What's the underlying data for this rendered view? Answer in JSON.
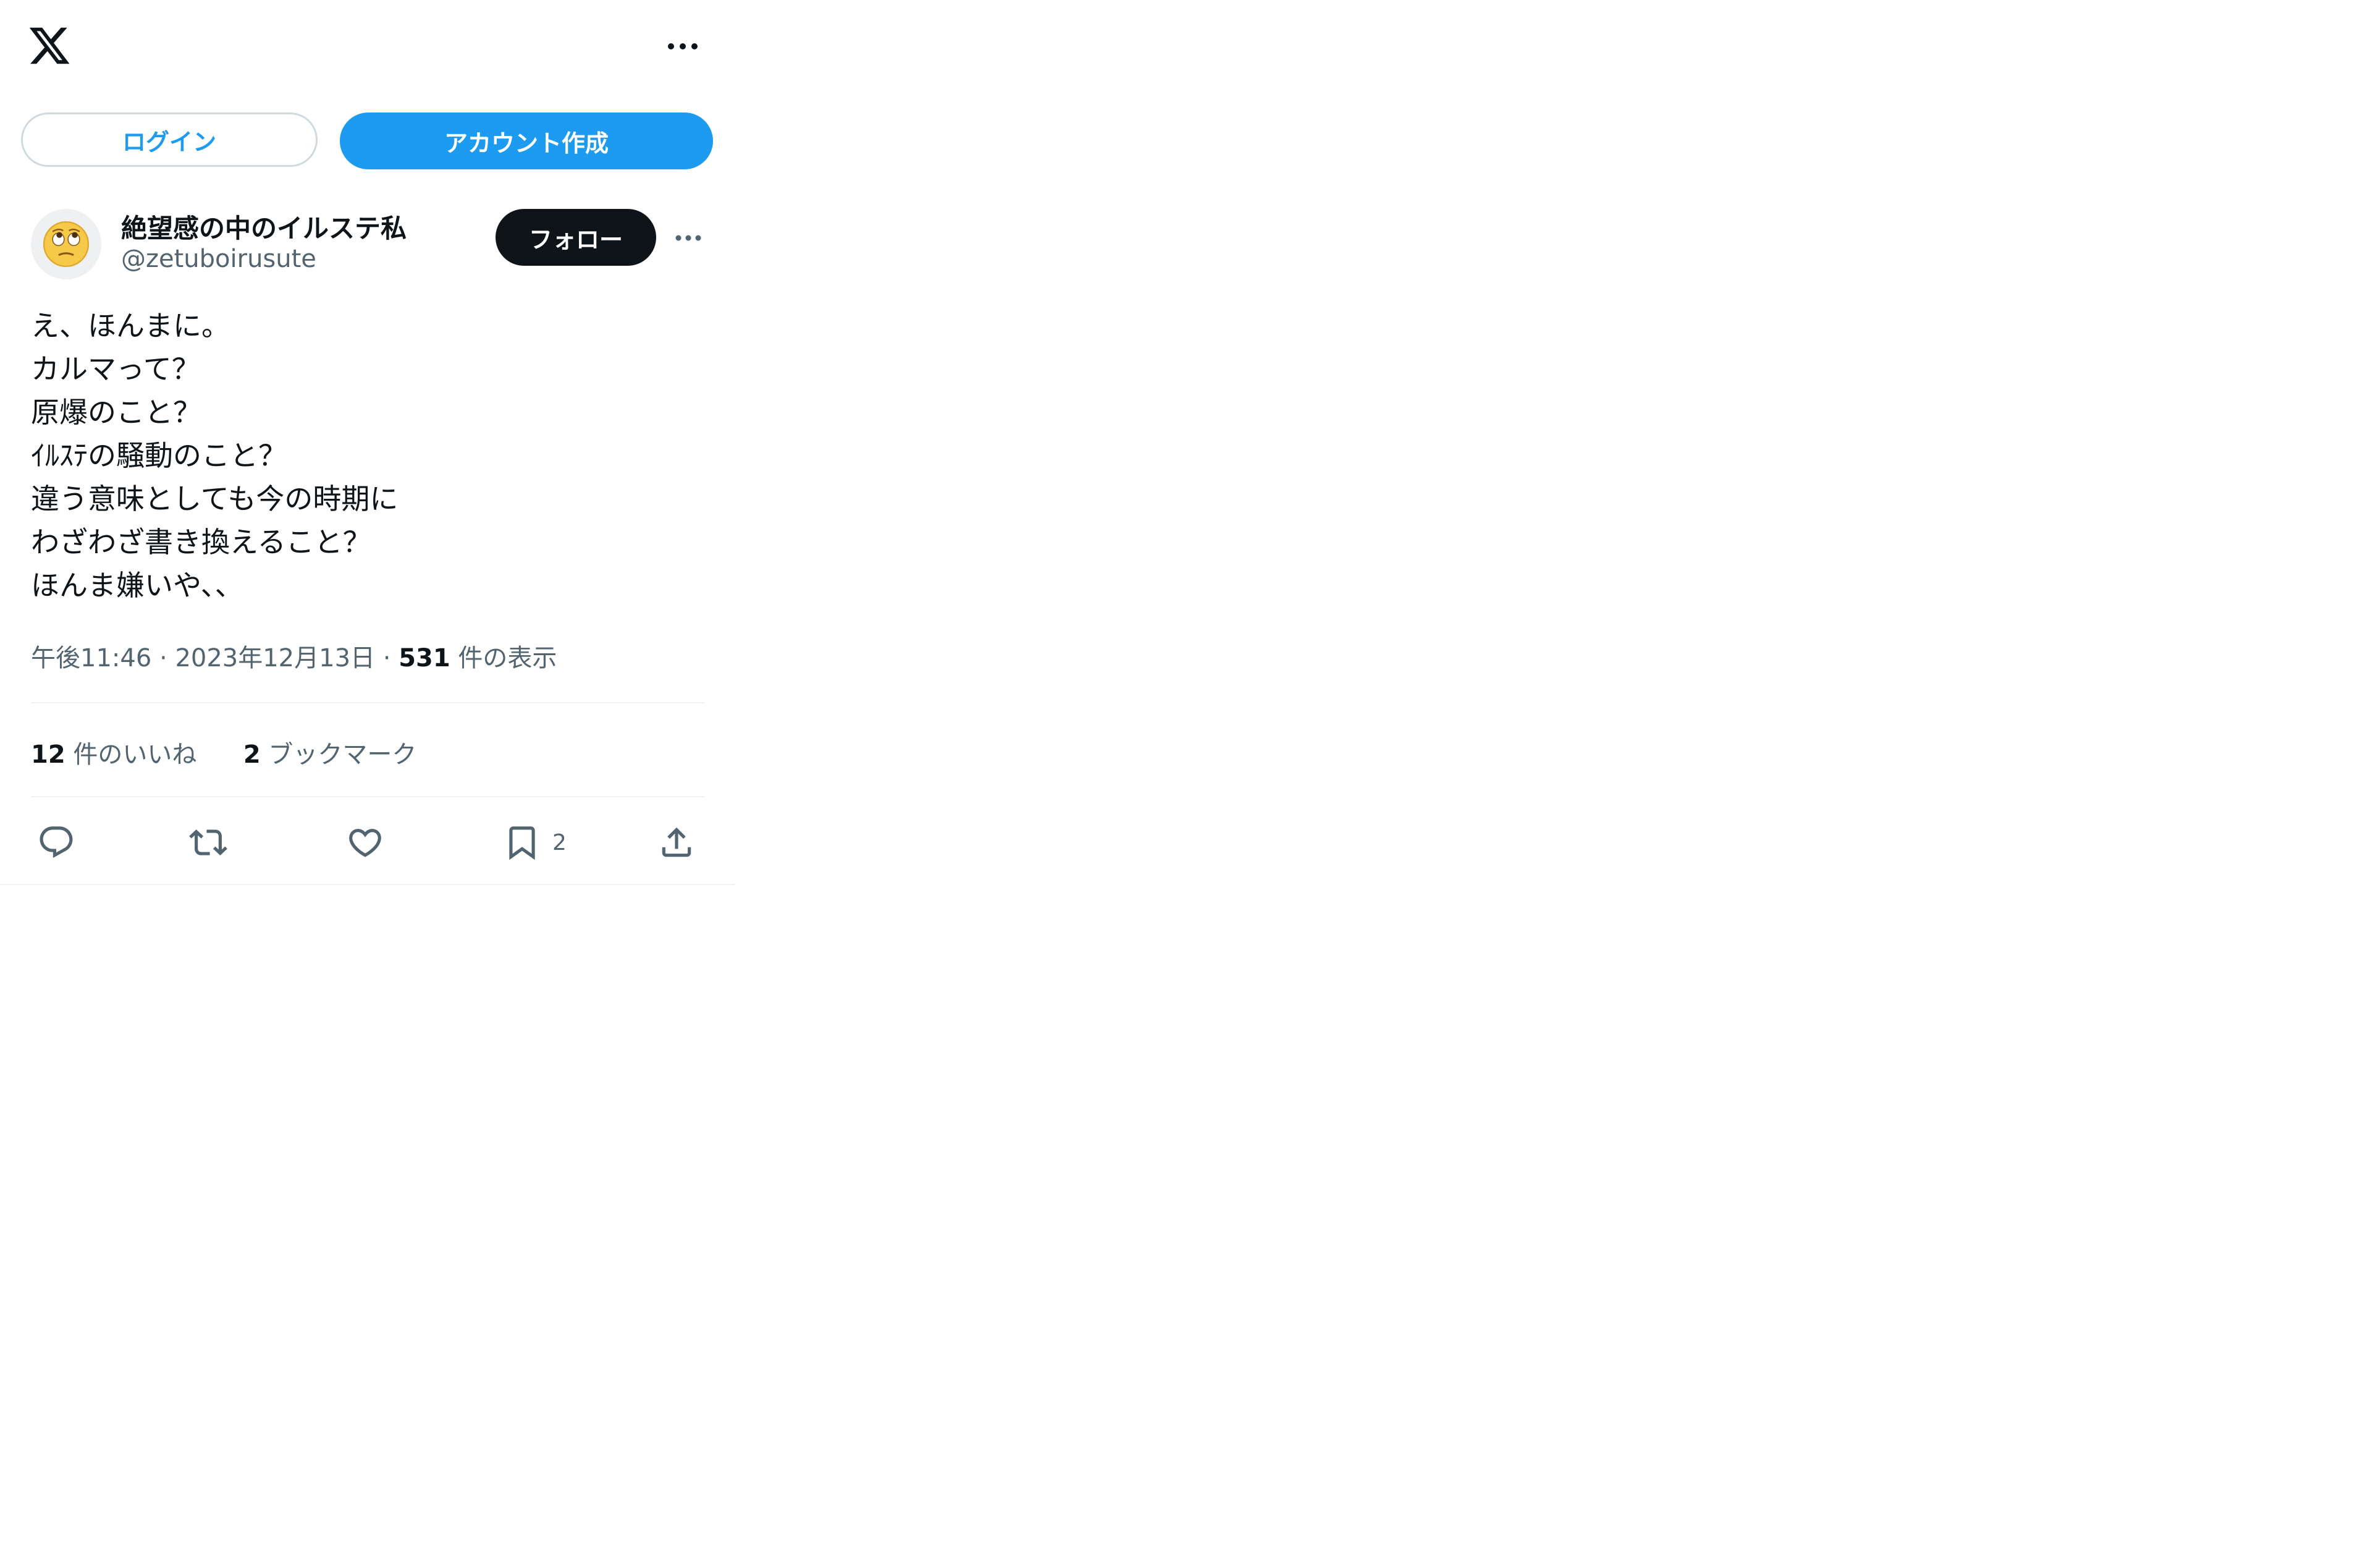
{
  "header": {
    "logo_icon": "x-logo-icon",
    "more_icon": "more-horizontal-icon"
  },
  "auth": {
    "login_label": "ログイン",
    "signup_label": "アカウント作成"
  },
  "tweet": {
    "author": {
      "display_name": "絶望感の中のイルステ私",
      "handle": "@zetuboirusute",
      "avatar_emoji": "🙄"
    },
    "follow_label": "フォロー",
    "text_lines": [
      "え、ほんまに。",
      "カルマって？",
      "原爆のこと？",
      "ｲﾙｽﾃの騒動のこと？",
      "違う意味としても今の時期に",
      "わざわざ書き換えること？",
      "ほんま嫌いや、、"
    ],
    "meta": {
      "time": "午後11:46",
      "dot1": "·",
      "date": "2023年12月13日",
      "dot2": "·",
      "views_count": "531",
      "views_label": "件の表示"
    },
    "stats": {
      "likes_count": "12",
      "likes_label": "件のいいね",
      "bookmarks_count": "2",
      "bookmarks_label": "ブックマーク"
    },
    "actions": {
      "reply_icon": "reply-icon",
      "retweet_icon": "retweet-icon",
      "like_icon": "heart-icon",
      "bookmark_icon": "bookmark-icon",
      "bookmark_count": "2",
      "share_icon": "share-icon"
    }
  },
  "colors": {
    "accent": "#1d9bf0",
    "text": "#0f1419",
    "muted": "#536471",
    "border": "#cfd9de",
    "divider": "#eff3f4"
  }
}
